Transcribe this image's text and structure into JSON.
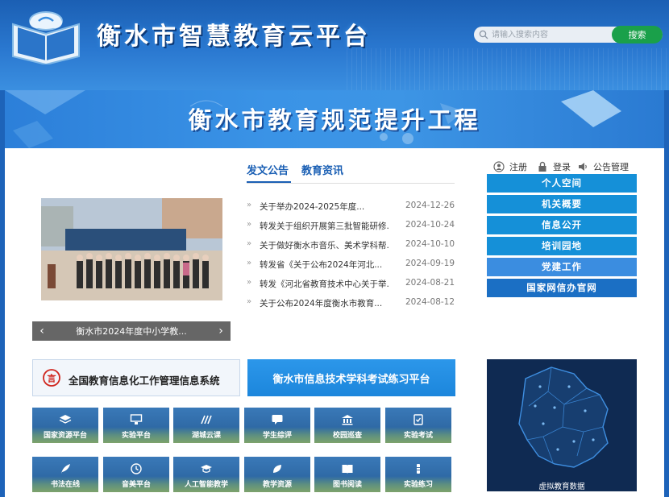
{
  "header": {
    "site_title": "衡水市智慧教育云平台",
    "search_placeholder": "请输入搜索内容",
    "search_button": "搜索"
  },
  "banner": {
    "title": "衡水市教育规范提升工程"
  },
  "carousel": {
    "caption": "衡水市2024年度中小学教...",
    "prev_icon": "chevron-left-icon",
    "next_icon": "chevron-right-icon"
  },
  "news": {
    "tabs": [
      {
        "label": "发文公告",
        "active": true
      },
      {
        "label": "教育资讯",
        "active": false
      }
    ],
    "items": [
      {
        "title": "关于举办2024-2025年度...",
        "date": "2024-12-26"
      },
      {
        "title": "转发关于组织开展第三批智能研修...",
        "date": "2024-10-24"
      },
      {
        "title": "关于做好衡水市音乐、美术学科帮...",
        "date": "2024-10-10"
      },
      {
        "title": "转发省《关于公布2024年河北...",
        "date": "2024-09-19"
      },
      {
        "title": "转发《河北省教育技术中心关于举...",
        "date": "2024-08-21"
      },
      {
        "title": "关于公布2024年度衡水市教育...",
        "date": "2024-08-12"
      }
    ]
  },
  "user_links": {
    "register": "注册",
    "login": "登录",
    "notice_admin": "公告管理"
  },
  "side_menu": [
    {
      "label": "个人空间"
    },
    {
      "label": "机关概要"
    },
    {
      "label": "信息公开"
    },
    {
      "label": "培训园地"
    },
    {
      "label": "党建工作"
    },
    {
      "label": "国家网信办官网"
    }
  ],
  "systems": {
    "info_system": "全国教育信息化工作管理信息系统",
    "exam_platform": "衡水市信息技术学科考试练习平台"
  },
  "tiles_row1": [
    {
      "label": "国家资源平台",
      "icon": "layers-icon"
    },
    {
      "label": "实验平台",
      "icon": "monitor-icon"
    },
    {
      "label": "湖城云课",
      "icon": "logo-text-icon"
    },
    {
      "label": "学生综评",
      "icon": "chat-icon"
    },
    {
      "label": "校园巡查",
      "icon": "building-icon"
    },
    {
      "label": "实验考试",
      "icon": "checklist-icon"
    }
  ],
  "tiles_row2": [
    {
      "label": "书法在线",
      "icon": "feather-icon"
    },
    {
      "label": "音美平台",
      "icon": "clock-icon"
    },
    {
      "label": "人工智能教学",
      "icon": "graduation-cap-icon"
    },
    {
      "label": "教学资源",
      "icon": "leaf-icon"
    },
    {
      "label": "图书阅读",
      "icon": "book-icon"
    },
    {
      "label": "实验练习",
      "icon": "flask-icon"
    }
  ],
  "map": {
    "label": "虚拟教育数据"
  },
  "colors": {
    "header_blue": "#1b5fb3",
    "accent_blue": "#1a5fb4",
    "menu_blue": "#1590d8",
    "search_green": "#1aa04a"
  }
}
